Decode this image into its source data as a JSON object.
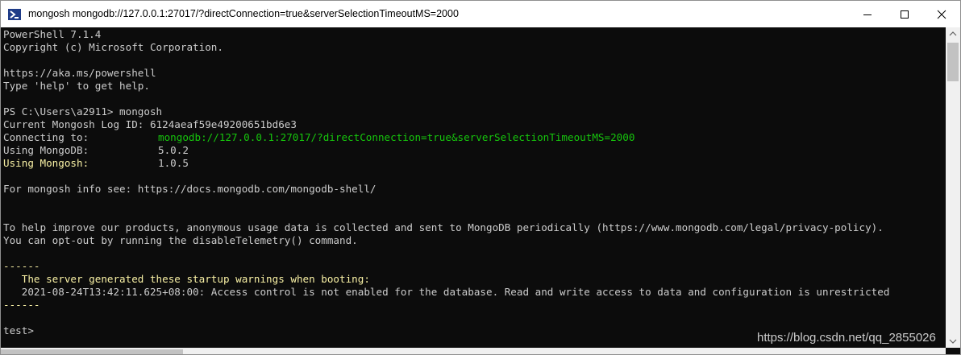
{
  "window": {
    "title": "mongosh mongodb://127.0.0.1:27017/?directConnection=true&serverSelectionTimeoutMS=2000",
    "icon": "powershell-icon"
  },
  "console": {
    "lines": [
      {
        "text": "PowerShell 7.1.4"
      },
      {
        "text": "Copyright (c) Microsoft Corporation."
      },
      {
        "text": ""
      },
      {
        "text": "https://aka.ms/powershell"
      },
      {
        "text": "Type 'help' to get help."
      },
      {
        "text": ""
      },
      {
        "text": "PS C:\\Users\\a2911> mongosh"
      },
      {
        "text": "Current Mongosh Log ID: 6124aeaf59e49200651bd6e3"
      },
      {
        "label": "Connecting to:",
        "value": "mongodb://127.0.0.1:27017/?directConnection=true&serverSelectionTimeoutMS=2000"
      },
      {
        "label": "Using MongoDB:",
        "value": "5.0.2"
      },
      {
        "label": "Using Mongosh:",
        "value": "1.0.5"
      },
      {
        "text": ""
      },
      {
        "text": "For mongosh info see: https://docs.mongodb.com/mongodb-shell/"
      },
      {
        "text": ""
      },
      {
        "text": ""
      },
      {
        "text": "To help improve our products, anonymous usage data is collected and sent to MongoDB periodically (https://www.mongodb.com/legal/privacy-policy)."
      },
      {
        "text": "You can opt-out by running the disableTelemetry() command."
      },
      {
        "text": ""
      },
      {
        "text": "------"
      },
      {
        "text": "   The server generated these startup warnings when booting:"
      },
      {
        "text": "   2021-08-24T13:42:11.625+08:00: Access control is not enabled for the database. Read and write access to data and configuration is unrestricted"
      },
      {
        "text": "------"
      },
      {
        "text": ""
      },
      {
        "text": "test>"
      }
    ]
  },
  "watermark": "https://blog.csdn.net/qq_2855026",
  "colors": {
    "background": "#0c0c0c",
    "text": "#cccccc",
    "green": "#16c60c",
    "yellow": "#f9f1a5"
  }
}
